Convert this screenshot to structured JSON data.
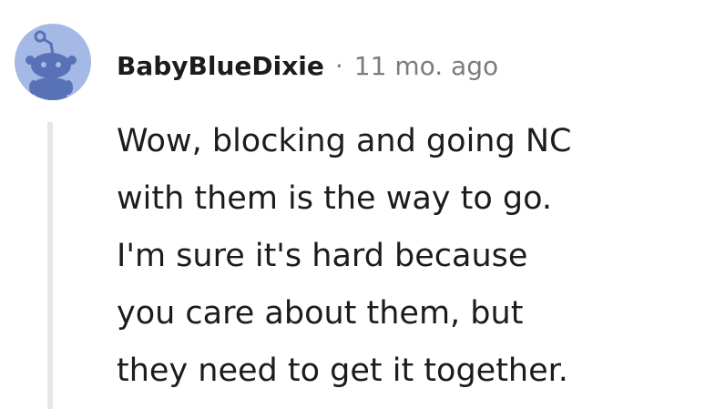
{
  "comment": {
    "author": "BabyBlueDixie",
    "separator": "·",
    "timestamp": "11 mo. ago",
    "body": "Wow, blocking and going NC\nwith them is the way to go.\nI'm sure it's hard because\nyou care about them, but\nthey need to get it together."
  },
  "avatar": {
    "icon": "reddit-snoo-icon",
    "background": "#a5b9e6",
    "foreground": "#5871b7"
  },
  "colors": {
    "text": "#1c1c1c",
    "muted": "#7c7c7c",
    "thread_line": "#e6e6e6"
  }
}
